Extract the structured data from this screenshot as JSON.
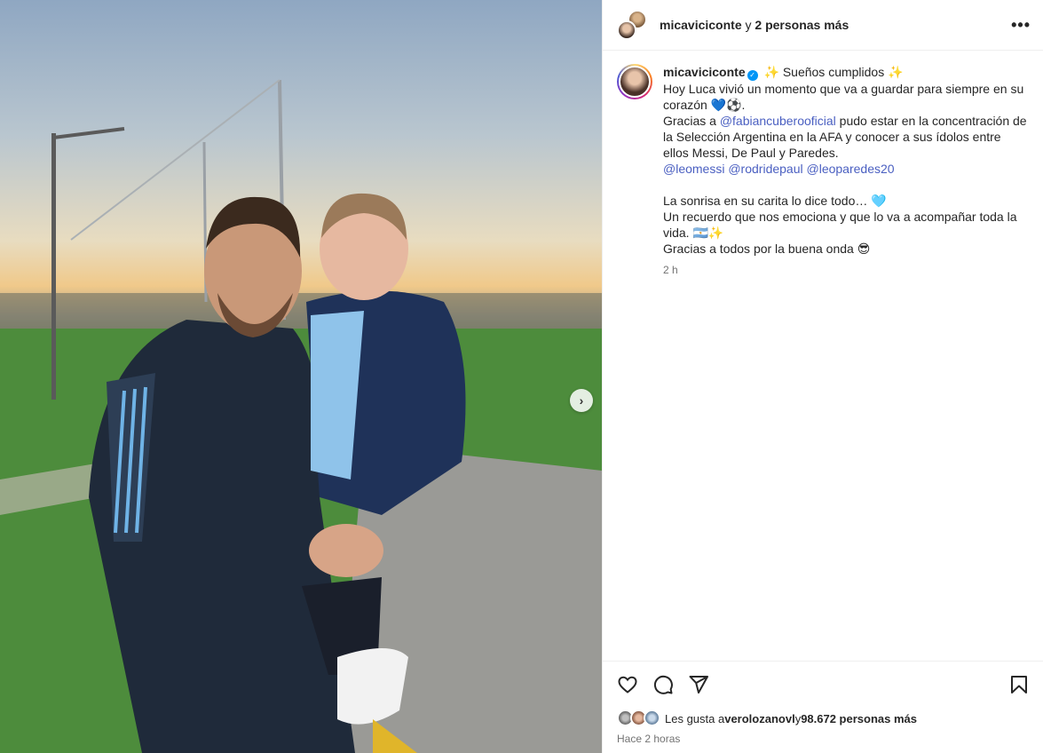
{
  "header": {
    "username": "micaviciconte",
    "joiner": " y ",
    "others": "2 personas más",
    "more_icon": "more-horizontal-icon"
  },
  "caption": {
    "username": "micaviciconte",
    "lines": [
      " ✨ Sueños cumplidos ✨",
      "Hoy Luca vivió un momento que va a guardar para siempre en su corazón 💙⚽.",
      "Gracias a ",
      "@fabiancuberooficial",
      " pudo estar en la concentración de la Selección Argentina en la AFA y conocer a sus ídolos entre ellos Messi, De Paul y Paredes.",
      "@leomessi",
      "@rodridepaul",
      "@leoparedes20",
      "La sonrisa en su carita lo dice todo… 🩵",
      "Un recuerdo que nos emociona y que lo va a acompañar toda la vida. 🇦🇷✨",
      "Gracias a todos por la buena onda 😎"
    ],
    "time": "2 h"
  },
  "actions": {
    "like_icon": "heart-icon",
    "comment_icon": "comment-icon",
    "share_icon": "paper-plane-icon",
    "save_icon": "bookmark-icon"
  },
  "likes": {
    "prefix": "Les gusta a ",
    "user": "verolozanovl",
    "joiner": " y ",
    "count": "98.672 personas más"
  },
  "posted": "Hace 2 horas",
  "carousel": {
    "next_icon": "chevron-right-icon"
  }
}
